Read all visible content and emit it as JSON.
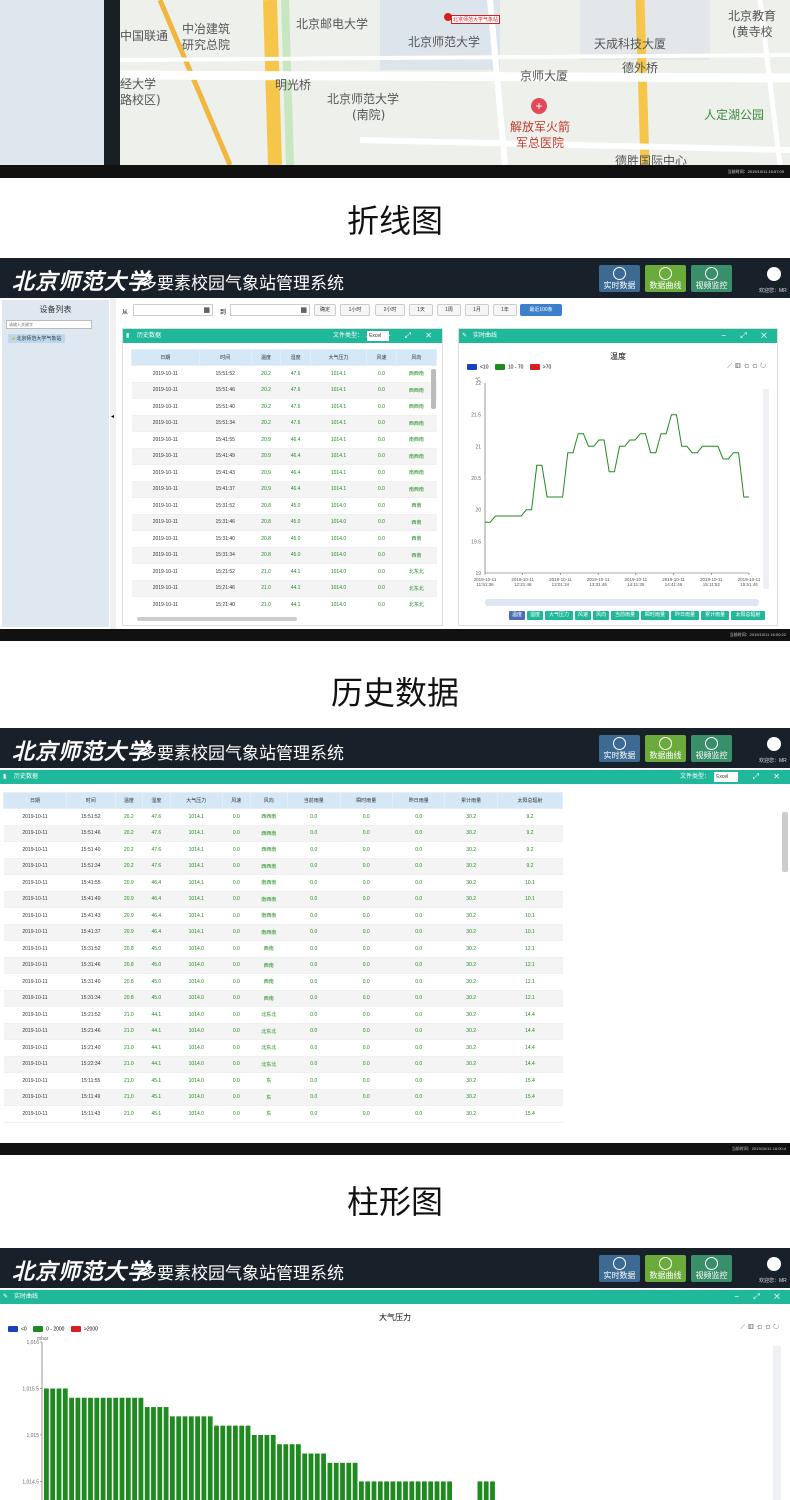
{
  "captions": {
    "line_chart": "折线图",
    "history": "历史数据",
    "bar_chart": "柱形图"
  },
  "app": {
    "title": "多要素校园气象站管理系统",
    "logo": "北京师范大学",
    "welcome": "欢迎您：MR"
  },
  "nav": {
    "realtime": "实时数据",
    "curve": "数据曲线",
    "video": "视频监控"
  },
  "map": {
    "labels": [
      "中国联通",
      "中冶建筑",
      "研究总院",
      "北京邮电大学",
      "北京师范大学",
      "北京教育",
      "(黄寺校",
      "天成科技大厦",
      "德外桥",
      "经大学",
      "路校区)",
      "明光桥",
      "北京师范大学",
      "(南院)",
      "京师大厦",
      "解放军火箭",
      "军总医院",
      "人定湖公园",
      "德胜国际中心"
    ],
    "marker": "北京师范大学气象站",
    "status": "当前时间：2019/10/11 15:57:09"
  },
  "screen2": {
    "device_list_title": "设备列表",
    "search_placeholder": "请输入关键字",
    "tree_item": "北京师范大学气象站",
    "from_label": "从",
    "to_label": "到",
    "confirm": "确定",
    "ranges": [
      "1小时",
      "2小时",
      "1天",
      "1周",
      "1月",
      "1年"
    ],
    "recent": "最近100条",
    "history_title": "历史数据",
    "filetype_label": "文件类型：",
    "filetype_value": "Excel",
    "realtime_title": "实时曲线",
    "chart_title": "温度",
    "legend": [
      "<10",
      "10 - 70",
      ">70"
    ],
    "columns": [
      "日期",
      "时间",
      "温度",
      "湿度",
      "大气压力",
      "风速",
      "风向"
    ],
    "rows": [
      [
        "2019-10-11",
        "15:51:52",
        "20.2",
        "47.6",
        "1014.1",
        "0.0",
        "西西南"
      ],
      [
        "2019-10-11",
        "15:51:46",
        "20.2",
        "47.6",
        "1014.1",
        "0.0",
        "西西南"
      ],
      [
        "2019-10-11",
        "15:51:40",
        "20.2",
        "47.6",
        "1014.1",
        "0.0",
        "西西南"
      ],
      [
        "2019-10-11",
        "15:51:34",
        "20.2",
        "47.6",
        "1014.1",
        "0.0",
        "西西南"
      ],
      [
        "2019-10-11",
        "15:41:55",
        "20.9",
        "46.4",
        "1014.1",
        "0.0",
        "南西南"
      ],
      [
        "2019-10-11",
        "15:41:49",
        "20.9",
        "46.4",
        "1014.1",
        "0.0",
        "南西南"
      ],
      [
        "2019-10-11",
        "15:41:43",
        "20.9",
        "46.4",
        "1014.1",
        "0.0",
        "南西南"
      ],
      [
        "2019-10-11",
        "15:41:37",
        "20.9",
        "46.4",
        "1014.1",
        "0.0",
        "南西南"
      ],
      [
        "2019-10-11",
        "15:31:52",
        "20.8",
        "45.0",
        "1014.0",
        "0.0",
        "西南"
      ],
      [
        "2019-10-11",
        "15:31:46",
        "20.8",
        "45.0",
        "1014.0",
        "0.0",
        "西南"
      ],
      [
        "2019-10-11",
        "15:31:40",
        "20.8",
        "45.0",
        "1014.0",
        "0.0",
        "西南"
      ],
      [
        "2019-10-11",
        "15:31:34",
        "20.8",
        "45.0",
        "1014.0",
        "0.0",
        "西南"
      ],
      [
        "2019-10-11",
        "15:21:52",
        "21.0",
        "44.1",
        "1014.0",
        "0.0",
        "北东北"
      ],
      [
        "2019-10-11",
        "15:21:46",
        "21.0",
        "44.1",
        "1014.0",
        "0.0",
        "北东北"
      ],
      [
        "2019-10-11",
        "15:21:40",
        "21.0",
        "44.1",
        "1014.0",
        "0.0",
        "北东北"
      ]
    ],
    "tags": [
      "温度",
      "湿度",
      "大气压力",
      "风速",
      "风向",
      "当前雨量",
      "瞬时雨量",
      "昨日雨量",
      "累计雨量",
      "太阳总辐射"
    ],
    "status": "当前时间：2019/10/11 16:00:22"
  },
  "screen3": {
    "history_title": "历史数据",
    "filetype_label": "文件类型：",
    "filetype_value": "Excel",
    "columns": [
      "日期",
      "时间",
      "温度",
      "湿度",
      "大气压力",
      "风速",
      "风向",
      "当前雨量",
      "瞬时雨量",
      "昨日雨量",
      "累计雨量",
      "太阳总辐射"
    ],
    "rows": [
      [
        "2019-10-11",
        "15:51:52",
        "20.2",
        "47.6",
        "1014.1",
        "0.0",
        "西西南",
        "0.0",
        "0.0",
        "0.0",
        "30.2",
        "9.2"
      ],
      [
        "2019-10-11",
        "15:51:46",
        "20.2",
        "47.6",
        "1014.1",
        "0.0",
        "西西南",
        "0.0",
        "0.0",
        "0.0",
        "30.2",
        "9.2"
      ],
      [
        "2019-10-11",
        "15:51:40",
        "20.2",
        "47.6",
        "1014.1",
        "0.0",
        "西西南",
        "0.0",
        "0.0",
        "0.0",
        "30.2",
        "9.2"
      ],
      [
        "2019-10-11",
        "15:51:34",
        "20.2",
        "47.6",
        "1014.1",
        "0.0",
        "西西南",
        "0.0",
        "0.0",
        "0.0",
        "30.2",
        "9.2"
      ],
      [
        "2019-10-11",
        "15:41:55",
        "20.9",
        "46.4",
        "1014.1",
        "0.0",
        "南西南",
        "0.0",
        "0.0",
        "0.0",
        "30.2",
        "10.1"
      ],
      [
        "2019-10-11",
        "15:41:49",
        "20.9",
        "46.4",
        "1014.1",
        "0.0",
        "南西南",
        "0.0",
        "0.0",
        "0.0",
        "30.2",
        "10.1"
      ],
      [
        "2019-10-11",
        "15:41:43",
        "20.9",
        "46.4",
        "1014.1",
        "0.0",
        "南西南",
        "0.0",
        "0.0",
        "0.0",
        "30.2",
        "10.1"
      ],
      [
        "2019-10-11",
        "15:41:37",
        "20.9",
        "46.4",
        "1014.1",
        "0.0",
        "南西南",
        "0.0",
        "0.0",
        "0.0",
        "30.2",
        "10.1"
      ],
      [
        "2019-10-11",
        "15:31:52",
        "20.8",
        "45.0",
        "1014.0",
        "0.0",
        "西南",
        "0.0",
        "0.0",
        "0.0",
        "30.2",
        "12.1"
      ],
      [
        "2019-10-11",
        "15:31:46",
        "20.8",
        "45.0",
        "1014.0",
        "0.0",
        "西南",
        "0.0",
        "0.0",
        "0.0",
        "30.2",
        "12.1"
      ],
      [
        "2019-10-11",
        "15:31:40",
        "20.8",
        "45.0",
        "1014.0",
        "0.0",
        "西南",
        "0.0",
        "0.0",
        "0.0",
        "30.2",
        "12.1"
      ],
      [
        "2019-10-11",
        "15:31:34",
        "20.8",
        "45.0",
        "1014.0",
        "0.0",
        "西南",
        "0.0",
        "0.0",
        "0.0",
        "30.2",
        "12.1"
      ],
      [
        "2019-10-11",
        "15:21:52",
        "21.0",
        "44.1",
        "1014.0",
        "0.0",
        "北东北",
        "0.0",
        "0.0",
        "0.0",
        "30.2",
        "14.4"
      ],
      [
        "2019-10-11",
        "15:21:46",
        "21.0",
        "44.1",
        "1014.0",
        "0.0",
        "北东北",
        "0.0",
        "0.0",
        "0.0",
        "30.2",
        "14.4"
      ],
      [
        "2019-10-11",
        "15:21:40",
        "21.0",
        "44.1",
        "1014.0",
        "0.0",
        "北东北",
        "0.0",
        "0.0",
        "0.0",
        "30.2",
        "14.4"
      ],
      [
        "2019-10-11",
        "15:22:34",
        "21.0",
        "44.1",
        "1014.0",
        "0.0",
        "北东北",
        "0.0",
        "0.0",
        "0.0",
        "30.2",
        "14.4"
      ],
      [
        "2019-10-11",
        "15:11:55",
        "21.0",
        "45.1",
        "1014.0",
        "0.0",
        "东",
        "0.0",
        "0.0",
        "0.0",
        "30.2",
        "15.4"
      ],
      [
        "2019-10-11",
        "15:11:49",
        "21.0",
        "45.1",
        "1014.0",
        "0.0",
        "东",
        "0.0",
        "0.0",
        "0.0",
        "30.2",
        "15.4"
      ],
      [
        "2019-10-11",
        "15:11:43",
        "21.0",
        "45.1",
        "1014.0",
        "0.0",
        "东",
        "0.0",
        "0.0",
        "0.0",
        "30.2",
        "15.4"
      ]
    ],
    "status": "当前时间：2019/10/11 16:00:4"
  },
  "screen4": {
    "realtime_title": "实时曲线",
    "chart_title": "大气压力",
    "legend": [
      "<0",
      "0 - 2000",
      ">2000"
    ]
  },
  "colors": {
    "teal": "#20b89a",
    "dark": "#182029",
    "green": "#1f8a1f",
    "blue": "#1c3fbf",
    "red": "#d81e1e"
  },
  "chart_data": [
    {
      "type": "line",
      "title": "温度",
      "ylim": [
        19,
        22
      ],
      "yticks": [
        "19",
        "19.5",
        "20",
        "20.5",
        "21",
        "21.5",
        "22"
      ],
      "ylabel": "℃",
      "xticks": [
        "2019-10-11 11:51:36",
        "2019-10-11 12:21:46",
        "2019-10-11 13:01:34",
        "2019-10-11 13:31:46",
        "2019-10-11 14:11:35",
        "2019-10-11 14:41:46",
        "2019-10-11 15:11:52",
        "2019-10-11 15:51:46"
      ],
      "series": [
        {
          "values": [
            19.8,
            19.8,
            19.9,
            19.9,
            19.9,
            19.9,
            19.9,
            19.9,
            20.0,
            20.0,
            20.7,
            20.7,
            20.2,
            20.2,
            20.2,
            20.2,
            20.9,
            20.9,
            21.2,
            21.2,
            21.0,
            21.0,
            21.1,
            21.1,
            20.6,
            20.6,
            21.0,
            21.0,
            21.1,
            21.1,
            21.2,
            21.2,
            20.9,
            20.9,
            21.2,
            21.2,
            21.5,
            21.5,
            21.0,
            21.0,
            20.9,
            20.9,
            21.0,
            21.0,
            21.0,
            21.0,
            20.8,
            20.8,
            20.9,
            20.9,
            20.2,
            20.2
          ]
        }
      ],
      "legend": [
        "<10",
        "10 - 70",
        ">70"
      ]
    },
    {
      "type": "bar",
      "title": "大气压力",
      "ylabel": "mbar",
      "ylim": [
        1014.3,
        1016.0
      ],
      "yticks": [
        "1,014.5",
        "1,015",
        "1,015.5",
        "1,016"
      ],
      "values": [
        1015.5,
        1015.5,
        1015.5,
        1015.5,
        1015.4,
        1015.4,
        1015.4,
        1015.4,
        1015.4,
        1015.4,
        1015.4,
        1015.4,
        1015.4,
        1015.4,
        1015.4,
        1015.4,
        1015.3,
        1015.3,
        1015.3,
        1015.3,
        1015.2,
        1015.2,
        1015.2,
        1015.2,
        1015.2,
        1015.2,
        1015.2,
        1015.1,
        1015.1,
        1015.1,
        1015.1,
        1015.1,
        1015.1,
        1015.0,
        1015.0,
        1015.0,
        1015.0,
        1014.9,
        1014.9,
        1014.9,
        1014.9,
        1014.8,
        1014.8,
        1014.8,
        1014.8,
        1014.7,
        1014.7,
        1014.7,
        1014.7,
        1014.7,
        1014.5,
        1014.5,
        1014.5,
        1014.5,
        1014.5,
        1014.5,
        1014.5,
        1014.5,
        1014.5,
        1014.5,
        1014.5,
        1014.5,
        1014.5,
        1014.5,
        1014.5,
        1014.5,
        1014.5,
        1014.5
      ],
      "legend": [
        "<0",
        "0 - 2000",
        ">2000"
      ]
    }
  ]
}
